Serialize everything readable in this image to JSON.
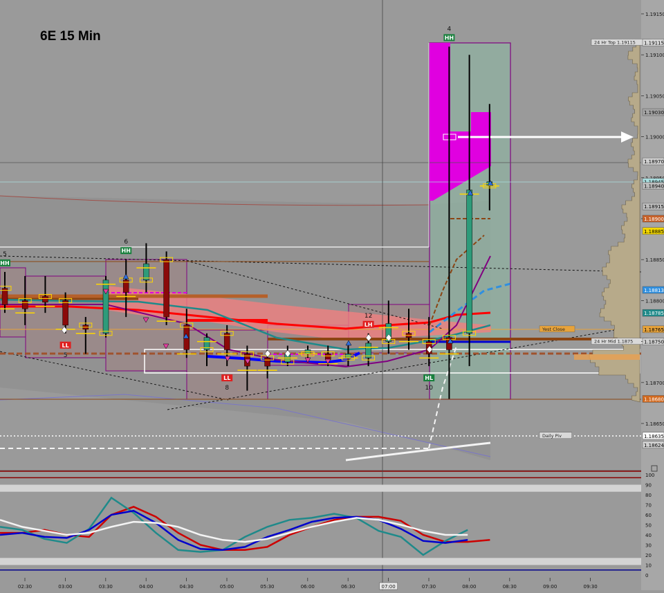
{
  "header": {
    "title": "6E 15 Min"
  },
  "chart_data": {
    "type": "candlestick",
    "title": "6E 15 Min",
    "x_ticks": [
      "02:30",
      "03:00",
      "03:30",
      "04:00",
      "04:30",
      "05:00",
      "05:30",
      "06:00",
      "06:30",
      "07:00",
      "07:30",
      "08:00",
      "08:30",
      "09:00",
      "09:30"
    ],
    "x_marker": "07:00",
    "y_ticks": [
      "1.19150",
      "1.19100",
      "1.19050",
      "1.19000",
      "1.18950",
      "1.18900",
      "1.18850",
      "1.18800",
      "1.18750",
      "1.18700",
      "1.18650"
    ],
    "ylim": [
      1.1862,
      1.1916
    ],
    "price_labels": [
      {
        "text": "1.19115",
        "value": 1.19115,
        "color": "#d9d9d9",
        "fg": "#000000"
      },
      {
        "text": "1.19030",
        "value": 1.1903,
        "color": "#a5a5a5",
        "fg": "#000000"
      },
      {
        "text": "1.18970",
        "value": 1.1897,
        "color": "#cfcfcf",
        "fg": "#000000"
      },
      {
        "text": "1.18945",
        "value": 1.18945,
        "color": "#a9dedf",
        "fg": "#000000"
      },
      {
        "text": "1.18940",
        "value": 1.1894,
        "color": "#bdbdbd",
        "fg": "#000000"
      },
      {
        "text": "1.18915",
        "value": 1.18915,
        "color": "#bdbdbd",
        "fg": "#000000"
      },
      {
        "text": "1.18900",
        "value": 1.189,
        "color": "#c8622a",
        "fg": "#ffffff"
      },
      {
        "text": "1.18885",
        "value": 1.18885,
        "color": "#f2d600",
        "fg": "#000000"
      },
      {
        "text": "1.18813",
        "value": 1.18813,
        "color": "#2f8fe0",
        "fg": "#ffffff"
      },
      {
        "text": "1.18785",
        "value": 1.18785,
        "color": "#1f8a8a",
        "fg": "#ffffff"
      },
      {
        "text": "1.18765",
        "value": 1.18765,
        "color": "#e8a33a",
        "fg": "#000000"
      },
      {
        "text": "1.18750",
        "value": 1.1875,
        "color": "#cfcfcf",
        "fg": "#000000"
      },
      {
        "text": "1.18680",
        "value": 1.1868,
        "color": "#d2691e",
        "fg": "#ffffff"
      },
      {
        "text": "1.18635",
        "value": 1.18635,
        "color": "#ffffff",
        "fg": "#000000"
      },
      {
        "text": "1.18624",
        "value": 1.18624,
        "color": "#cfcfcf",
        "fg": "#000000"
      }
    ],
    "level_labels": [
      {
        "text": "24 Hr Top  1.19115",
        "value": 1.19115,
        "pos": "right"
      },
      {
        "text": "Yest Close",
        "value": 1.18765,
        "pos": "right"
      },
      {
        "text": "24 Hr Mid  1.1875",
        "value": 1.1875,
        "pos": "right"
      },
      {
        "text": "Daily Piv",
        "value": 1.18635,
        "pos": "right"
      }
    ],
    "swing_markers": [
      {
        "number": "4",
        "tag": "HH",
        "bar": 22,
        "where": "top"
      },
      {
        "number": "5",
        "tag": "HH",
        "bar": 0,
        "where": "top"
      },
      {
        "number": "6",
        "tag": "HH",
        "bar": 6,
        "where": "top"
      },
      {
        "number": "12",
        "tag": "LH",
        "bar": 18,
        "where": "top"
      },
      {
        "number": "5",
        "tag": "LL",
        "bar": 3,
        "where": "bottom"
      },
      {
        "number": "8",
        "tag": "LL",
        "bar": 11,
        "where": "bottom"
      },
      {
        "number": "10",
        "tag": "HL",
        "bar": 21,
        "where": "bottom"
      }
    ],
    "series": [
      {
        "name": "",
        "candles": [
          {
            "t": "02:00",
            "o": 1.18815,
            "h": 1.18835,
            "l": 1.18785,
            "c": 1.18795
          },
          {
            "t": "02:15",
            "o": 1.188,
            "h": 1.1883,
            "l": 1.1877,
            "c": 1.1879
          },
          {
            "t": "02:30",
            "o": 1.18805,
            "h": 1.1883,
            "l": 1.18785,
            "c": 1.18798
          },
          {
            "t": "02:45",
            "o": 1.188,
            "h": 1.1881,
            "l": 1.1876,
            "c": 1.1877
          },
          {
            "t": "03:00",
            "o": 1.1877,
            "h": 1.1878,
            "l": 1.18735,
            "c": 1.18765
          },
          {
            "t": "03:15",
            "o": 1.1876,
            "h": 1.1883,
            "l": 1.18755,
            "c": 1.18825
          },
          {
            "t": "03:30",
            "o": 1.18825,
            "h": 1.1885,
            "l": 1.1878,
            "c": 1.1881
          },
          {
            "t": "03:45",
            "o": 1.18825,
            "h": 1.1887,
            "l": 1.1881,
            "c": 1.18845
          },
          {
            "t": "04:00",
            "o": 1.1885,
            "h": 1.1886,
            "l": 1.1877,
            "c": 1.1878
          },
          {
            "t": "04:15",
            "o": 1.1877,
            "h": 1.1879,
            "l": 1.1873,
            "c": 1.1874
          },
          {
            "t": "04:30",
            "o": 1.1874,
            "h": 1.1876,
            "l": 1.1872,
            "c": 1.18755
          },
          {
            "t": "04:45",
            "o": 1.1876,
            "h": 1.1877,
            "l": 1.1872,
            "c": 1.1874
          },
          {
            "t": "05:00",
            "o": 1.18735,
            "h": 1.18745,
            "l": 1.1869,
            "c": 1.1872
          },
          {
            "t": "05:15",
            "o": 1.1873,
            "h": 1.1874,
            "l": 1.18705,
            "c": 1.1872
          },
          {
            "t": "05:30",
            "o": 1.18725,
            "h": 1.18745,
            "l": 1.1872,
            "c": 1.18735
          },
          {
            "t": "05:45",
            "o": 1.18735,
            "h": 1.18745,
            "l": 1.18725,
            "c": 1.1874
          },
          {
            "t": "06:00",
            "o": 1.18735,
            "h": 1.18745,
            "l": 1.1872,
            "c": 1.18728
          },
          {
            "t": "06:15",
            "o": 1.1873,
            "h": 1.18745,
            "l": 1.1872,
            "c": 1.18735
          },
          {
            "t": "06:30",
            "o": 1.1873,
            "h": 1.1876,
            "l": 1.1872,
            "c": 1.18748
          },
          {
            "t": "06:45",
            "o": 1.1875,
            "h": 1.188,
            "l": 1.18735,
            "c": 1.18772
          },
          {
            "t": "07:00",
            "o": 1.1876,
            "h": 1.1879,
            "l": 1.1874,
            "c": 1.18755
          },
          {
            "t": "07:15",
            "o": 1.1875,
            "h": 1.1878,
            "l": 1.1872,
            "c": 1.18735
          },
          {
            "t": "07:30",
            "o": 1.18755,
            "h": 1.1911,
            "l": 1.1868,
            "c": 1.1874
          },
          {
            "t": "07:45",
            "o": 1.1876,
            "h": 1.191,
            "l": 1.1872,
            "c": 1.18935
          },
          {
            "t": "08:00",
            "o": 1.1894,
            "h": 1.1904,
            "l": 1.1891,
            "c": 1.18945
          }
        ]
      },
      {
        "name": "",
        "color": "#cc0000",
        "values": []
      },
      {
        "name": "",
        "color": "#1f8a8a",
        "values": []
      },
      {
        "name": "",
        "color": "#0000cc",
        "values": []
      },
      {
        "name": "",
        "color": "#f4f4f4",
        "values": []
      }
    ],
    "oscillator": {
      "y_ticks": [
        "100",
        "90",
        "80",
        "70",
        "60",
        "50",
        "40",
        "30",
        "20",
        "10",
        "0"
      ],
      "ylim": [
        -3,
        103
      ],
      "series": [
        {
          "name": "",
          "color": "#cc0000",
          "values": [
            42,
            42,
            45,
            40,
            38,
            60,
            68,
            58,
            42,
            30,
            25,
            25,
            28,
            40,
            48,
            55,
            58,
            58,
            54,
            40,
            33,
            33,
            35
          ]
        },
        {
          "name": "",
          "color": "#1f8a8a",
          "values": [
            48,
            45,
            36,
            32,
            46,
            77,
            62,
            42,
            25,
            23,
            25,
            38,
            48,
            55,
            57,
            61,
            57,
            44,
            38,
            20,
            34,
            45
          ]
        },
        {
          "name": "",
          "color": "#0000cc",
          "values": [
            40,
            42,
            38,
            37,
            45,
            60,
            64,
            52,
            35,
            26,
            25,
            28,
            38,
            45,
            53,
            57,
            58,
            55,
            46,
            34,
            32,
            35
          ]
        },
        {
          "name": "",
          "color": "#f4f4f4",
          "values": [
            55,
            48,
            44,
            40,
            42,
            48,
            53,
            52,
            48,
            40,
            35,
            33,
            36,
            42,
            48,
            53,
            57,
            55,
            50,
            44,
            40,
            40
          ]
        }
      ]
    },
    "annotations": [
      "24 Hr Top  1.19115",
      "Yest Close",
      "24 Hr Mid  1.1875",
      "Daily Piv"
    ],
    "colors": {
      "background": "#9a9a9a",
      "bull_candle": "#2e9b7a",
      "bear_candle": "#8b0a0a",
      "magenta": "#e000e0",
      "salmon_band": "#f08080",
      "profile": "#b7aa8a",
      "accent_brown": "#b5602a"
    },
    "grid": false,
    "legend": "none"
  }
}
